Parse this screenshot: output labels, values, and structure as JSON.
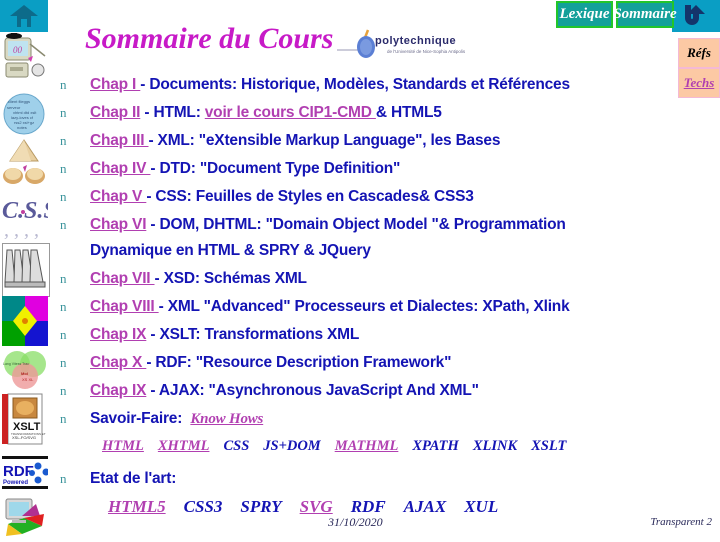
{
  "nav": {
    "home_icon": "home-icon",
    "up_icon": "uturn-up-arrow-icon",
    "lexique": "Lexique",
    "sommaire": "Sommaire",
    "refs": "Réfs",
    "techs": "Techs"
  },
  "header": {
    "title": "Sommaire du Cours",
    "logo_text": "polytechnique",
    "logo_sub": "de l'Université de Nice-Sophia Antipolis"
  },
  "sidebar": {
    "items": [
      {
        "name": "computer-teacher-image"
      },
      {
        "name": "globe-keywords-image"
      },
      {
        "name": "pyramid-cookies-image"
      },
      {
        "name": "css-logo-image"
      },
      {
        "name": "dtd-columns-image"
      },
      {
        "name": "dom-colors-image"
      },
      {
        "name": "xsd-venn-image"
      },
      {
        "name": "xslt-book-image"
      },
      {
        "name": "rdf-powered-image"
      },
      {
        "name": "ajax-computer-image"
      }
    ]
  },
  "chapters": [
    {
      "bullet": "n",
      "link": "Chap I ",
      "rest": "- Documents: Historique, Modèles, Standards et Références"
    },
    {
      "bullet": "n",
      "link": "Chap II",
      "rest_a": " - HTML: ",
      "link2": "voir le cours CIP1-CMD ",
      "rest_b": "& HTML5"
    },
    {
      "bullet": "n",
      "link": "Chap III ",
      "rest": "- XML:  \"eXtensible Markup Language\", les Bases"
    },
    {
      "bullet": "n",
      "link": "Chap IV ",
      "rest": "- DTD: \"Document Type Definition\""
    },
    {
      "bullet": "n",
      "link": "Chap V ",
      "rest": "- CSS: Feuilles de Styles en Cascades& CSS3"
    },
    {
      "bullet": "n",
      "link": "Chap VI",
      "rest": " - DOM, DHTML: \"Domain Object Model \"& Programmation Dynamique en HTML & SPRY & JQuery"
    },
    {
      "bullet": "n",
      "link": "Chap VII ",
      "rest": "- XSD: Schémas XML"
    },
    {
      "bullet": "n",
      "link": "Chap VIII ",
      "rest": "- XML \"Advanced\" Processeurs et Dialectes: XPath, Xlink"
    },
    {
      "bullet": "n",
      "link": "Chap IX",
      "rest": " - XSLT: Transformations XML"
    },
    {
      "bullet": "n",
      "link": "Chap X ",
      "rest": "- RDF: \"Resource Description Framework\""
    },
    {
      "bullet": "n",
      "link": "Chap IX",
      "rest": " - AJAX: \"Asynchronous JavaScript And XML\""
    }
  ],
  "savoir_faire": {
    "bullet": "n",
    "label": "Savoir-Faire:",
    "link": "Know Hows ",
    "techs": [
      {
        "label": "HTML",
        "highlight": true
      },
      {
        "label": "XHTML",
        "highlight": true
      },
      {
        "label": "CSS",
        "highlight": false
      },
      {
        "label": "JS+DOM",
        "highlight": false
      },
      {
        "label": "MATHML",
        "highlight": true
      },
      {
        "label": "XPATH",
        "highlight": false
      },
      {
        "label": "XLINK",
        "highlight": false
      },
      {
        "label": "XSLT",
        "highlight": false
      }
    ]
  },
  "etat_art": {
    "bullet": "n",
    "label": "Etat de l'art:",
    "techs": [
      {
        "label": "HTML5",
        "highlight": true
      },
      {
        "label": "CSS3",
        "highlight": false
      },
      {
        "label": "SPRY",
        "highlight": false
      },
      {
        "label": "SVG",
        "highlight": true
      },
      {
        "label": "RDF",
        "highlight": false
      },
      {
        "label": "AJAX",
        "highlight": false
      },
      {
        "label": "XUL",
        "highlight": false
      }
    ]
  },
  "footer": {
    "date": "31/10/2020",
    "page": "Transparent 2"
  },
  "colors": {
    "nav_bg": "#0a9ec4",
    "navbtn_bg": "#13a09a",
    "navbtn_border": "#22c52a",
    "sidebtn_bg": "#fcc9a4",
    "title": "#c71ac7",
    "body_text": "#1414b4",
    "link": "#b13fb1",
    "bullet": "#39939b"
  }
}
